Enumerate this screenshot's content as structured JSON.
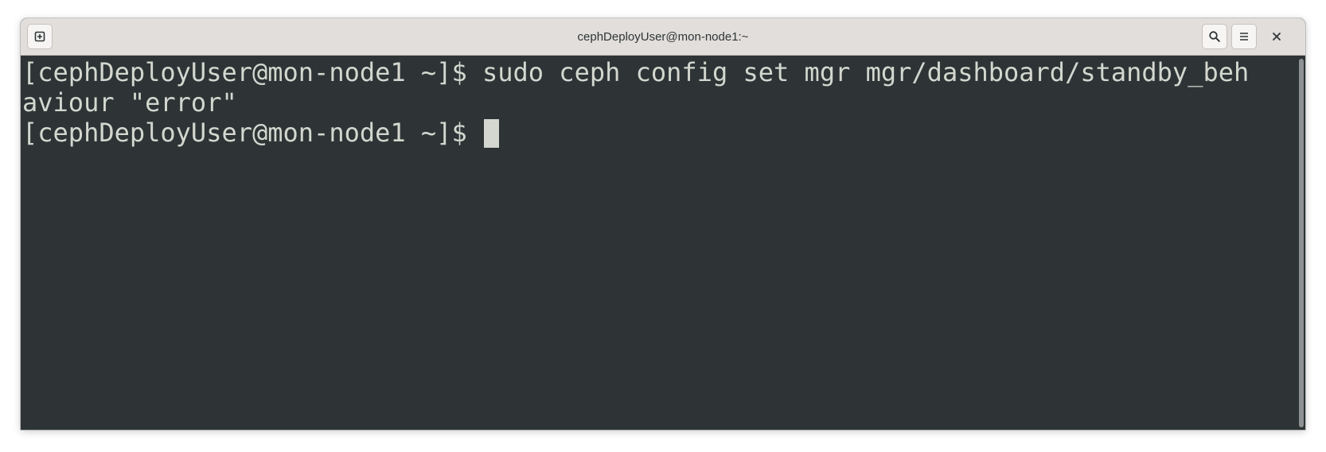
{
  "window": {
    "title": "cephDeployUser@mon-node1:~"
  },
  "titlebar": {
    "new_tab_icon": "new-tab-icon",
    "search_icon": "search-icon",
    "menu_icon": "hamburger-menu-icon",
    "close_icon": "close-icon"
  },
  "terminal": {
    "lines": [
      "[cephDeployUser@mon-node1 ~]$ sudo ceph config set mgr mgr/dashboard/standby_beh",
      "aviour \"error\"",
      "[cephDeployUser@mon-node1 ~]$ "
    ],
    "colors": {
      "background": "#2e3436",
      "foreground": "#d3d7cf"
    }
  }
}
